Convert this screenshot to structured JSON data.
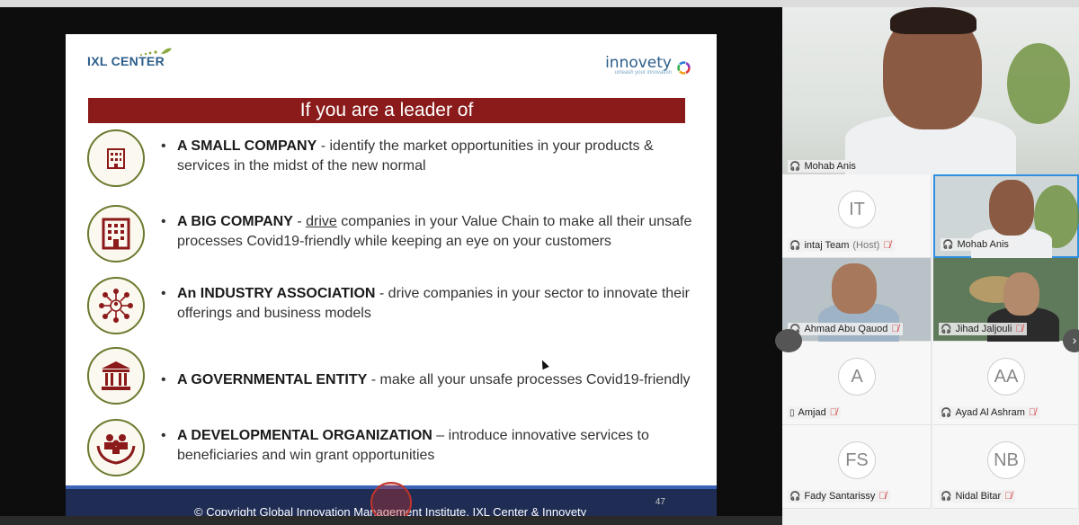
{
  "slide": {
    "logo_left": "IXL CENTER",
    "logo_right": "innovety",
    "logo_right_tag": "unleash your innovation",
    "banner": "If you are a leader of",
    "items": [
      {
        "icon": "small-building-icon",
        "bold": "A SMALL COMPANY",
        "rest": " - identify the market opportunities in your products & services in the midst of the new normal"
      },
      {
        "icon": "big-building-icon",
        "bold": "A BIG COMPANY",
        "pre_u": " - ",
        "underlined": "drive",
        "rest": " companies in your Value Chain to make all their unsafe processes Covid19-friendly while keeping an eye on your customers"
      },
      {
        "icon": "network-people-icon",
        "bold": "An INDUSTRY ASSOCIATION",
        "rest": " - drive companies in your sector to innovate their offerings and business models"
      },
      {
        "icon": "government-building-icon",
        "bold": "A GOVERNMENTAL ENTITY",
        "rest": " - make all your unsafe processes Covid19-friendly"
      },
      {
        "icon": "hands-people-icon",
        "bold": "A DEVELOPMENTAL ORGANIZATION",
        "rest": " – introduce innovative services to beneficiaries and win grant opportunities"
      }
    ],
    "footer": "© Copyright Global Innovation Management Institute, IXL Center & Innovety",
    "page_number": "47"
  },
  "gallery": {
    "speaker": "Mohab Anis",
    "participants": [
      {
        "initials": "IT",
        "name": "intaj Team",
        "suffix": "(Host)",
        "muted": true,
        "video": false
      },
      {
        "initials": "",
        "name": "Mohab Anis",
        "suffix": "",
        "muted": false,
        "video": true
      },
      {
        "initials": "",
        "name": "Ahmad Abu Qauod",
        "suffix": "",
        "muted": true,
        "video": true
      },
      {
        "initials": "",
        "name": "Jihad Jaljouli",
        "suffix": "",
        "muted": true,
        "video": true
      },
      {
        "initials": "A",
        "name": "Amjad",
        "suffix": "",
        "muted": true,
        "video": false
      },
      {
        "initials": "AA",
        "name": "Ayad Al Ashram",
        "suffix": "",
        "muted": true,
        "video": false
      },
      {
        "initials": "FS",
        "name": "Fady Santarissy",
        "suffix": "",
        "muted": true,
        "video": false
      },
      {
        "initials": "NB",
        "name": "Nidal Bitar",
        "suffix": "",
        "muted": true,
        "video": false
      }
    ]
  },
  "colors": {
    "banner": "#8b1a1a",
    "icon_border": "#6b7a2e",
    "footer": "#1f2d55",
    "active_border": "#2f8fe0"
  }
}
